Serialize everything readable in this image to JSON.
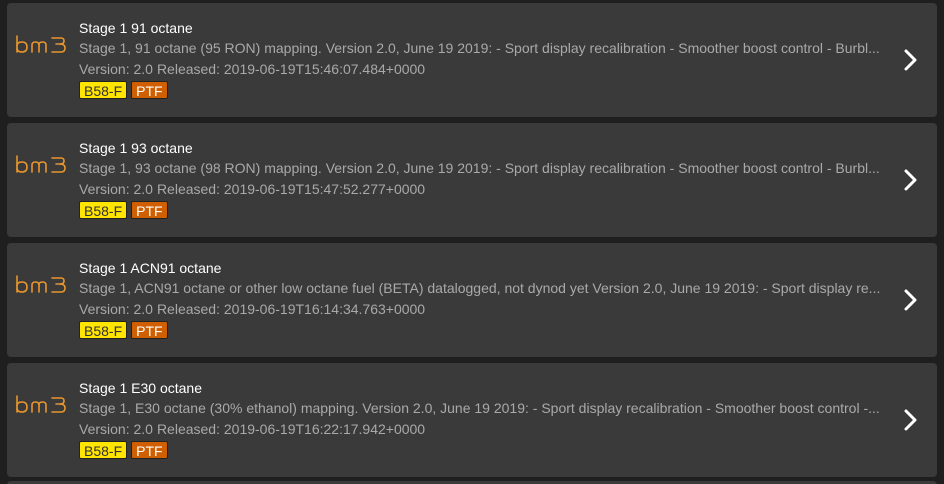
{
  "colors": {
    "brand_orange": "#e8962e",
    "car_tag_bg": "#ffe500",
    "ptf_tag_bg": "#cf5f00",
    "card_bg": "#3a3a3a"
  },
  "brand_logo_text": "bm3",
  "maps": [
    {
      "title": "Stage 1 91 octane",
      "description": "Stage 1, 91 octane (95 RON) mapping. Version 2.0, June 19 2019: - Sport display recalibration - Smoother boost control - Burbl...",
      "version_label": "Version: 2.0",
      "released_label": "Released: 2019-06-19T15:46:07.484+0000",
      "tags": {
        "car": "B58-F",
        "type": "PTF"
      },
      "icon": "chevron-right-icon"
    },
    {
      "title": "Stage 1 93 octane",
      "description": "Stage 1, 93 octane (98 RON) mapping. Version 2.0, June 19 2019: - Sport display recalibration - Smoother boost control - Burbl...",
      "version_label": "Version: 2.0",
      "released_label": "Released: 2019-06-19T15:47:52.277+0000",
      "tags": {
        "car": "B58-F",
        "type": "PTF"
      },
      "icon": "chevron-right-icon"
    },
    {
      "title": "Stage 1 ACN91 octane",
      "description": "Stage 1, ACN91 octane or other low octane fuel (BETA) datalogged, not dynod yet Version 2.0, June 19 2019: - Sport display re...",
      "version_label": "Version: 2.0",
      "released_label": "Released: 2019-06-19T16:14:34.763+0000",
      "tags": {
        "car": "B58-F",
        "type": "PTF"
      },
      "icon": "chevron-right-icon"
    },
    {
      "title": "Stage 1 E30 octane",
      "description": "Stage 1, E30 octane (30% ethanol) mapping. Version 2.0, June 19 2019: - Sport display recalibration - Smoother boost control -...",
      "version_label": "Version: 2.0",
      "released_label": "Released: 2019-06-19T16:22:17.942+0000",
      "tags": {
        "car": "B58-F",
        "type": "PTF"
      },
      "icon": "chevron-right-icon"
    }
  ]
}
